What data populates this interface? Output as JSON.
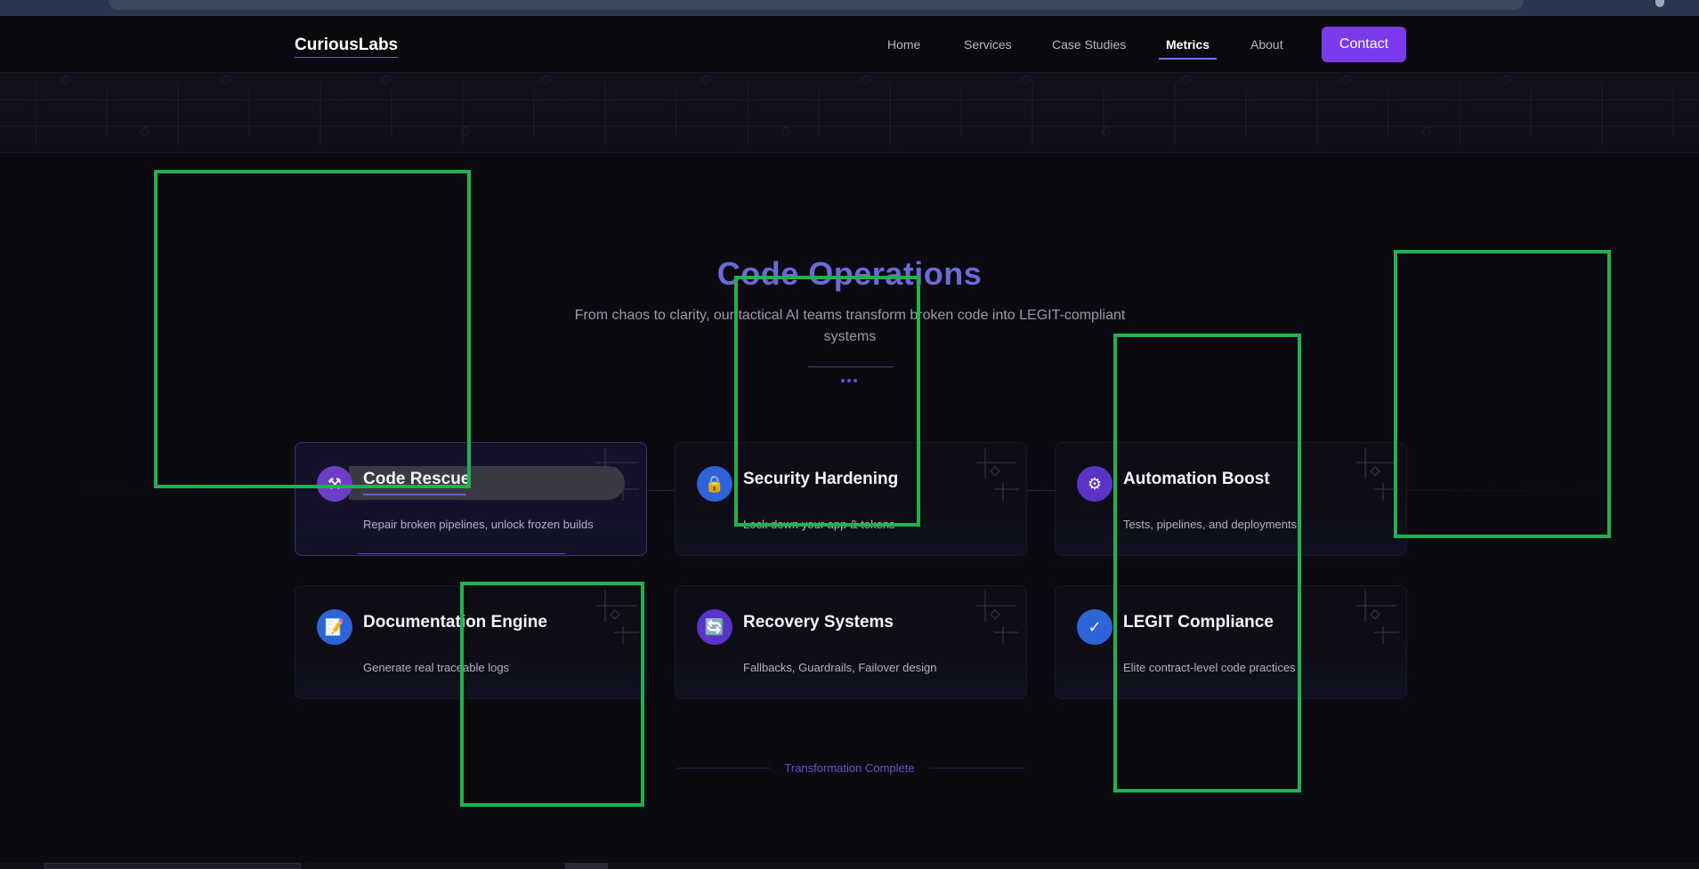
{
  "colors": {
    "background": "#0b0a10",
    "accent": "#7c3aed",
    "title": "#6a6bd8",
    "overlay": "#23b14d"
  },
  "navbar": {
    "logo": "CuriousLabs",
    "links": [
      {
        "label": "Home",
        "active": false
      },
      {
        "label": "Services",
        "active": false
      },
      {
        "label": "Case Studies",
        "active": false
      },
      {
        "label": "Metrics",
        "active": true
      },
      {
        "label": "About",
        "active": false
      }
    ],
    "contact_label": "Contact"
  },
  "hero": {
    "title": "Code Operations",
    "subtitle": "From chaos to clarity, our tactical AI teams transform broken code into LEGIT-compliant systems"
  },
  "cards": [
    {
      "title": "Code Rescue",
      "desc": "Repair broken pipelines, unlock frozen builds",
      "icon": "wrench-icon",
      "highlighted": true
    },
    {
      "title": "Security Hardening",
      "desc": "Lock down your app & tokens",
      "icon": "lock-icon",
      "highlighted": false
    },
    {
      "title": "Automation Boost",
      "desc": "Tests, pipelines, and deployments",
      "icon": "gear-icon",
      "highlighted": false
    },
    {
      "title": "Documentation Engine",
      "desc": "Generate real traceable logs",
      "icon": "document-icon",
      "highlighted": false
    },
    {
      "title": "Recovery Systems",
      "desc": "Fallbacks, Guardrails, Failover design",
      "icon": "refresh-icon",
      "highlighted": false
    },
    {
      "title": "LEGIT Compliance",
      "desc": "Elite contract-level code practices",
      "icon": "checkmark-icon",
      "highlighted": false
    }
  ],
  "footer": {
    "status": "Transformation Complete"
  }
}
